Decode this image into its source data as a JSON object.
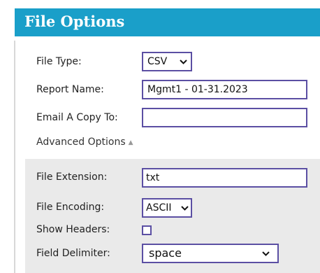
{
  "header": {
    "title": "File Options"
  },
  "form": {
    "file_type": {
      "label": "File Type:",
      "value": "CSV"
    },
    "report_name": {
      "label": "Report Name:",
      "value": "Mgmt1 - 01-31.2023"
    },
    "email_copy": {
      "label": "Email A Copy To:",
      "value": ""
    }
  },
  "advanced": {
    "toggle_label": "Advanced Options",
    "caret": "▲",
    "file_extension": {
      "label": "File Extension:",
      "value": "txt"
    },
    "file_encoding": {
      "label": "File Encoding:",
      "value": "ASCII"
    },
    "show_headers": {
      "label": "Show Headers:",
      "checked": false
    },
    "field_delimiter": {
      "label": "Field Delimiter:",
      "value": "space"
    }
  },
  "icons": {
    "dropdown": "chevron-down-icon"
  },
  "colors": {
    "header_bg": "#1a9fc9",
    "input_border": "#5b4fa3",
    "advanced_bg": "#eaeaea"
  }
}
